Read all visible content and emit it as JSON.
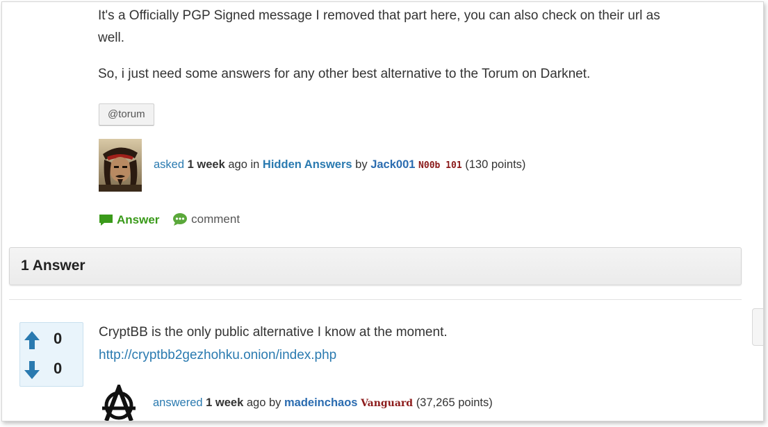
{
  "question": {
    "body_lines": [
      "It's a Officially PGP Signed message I removed that part here, you can also check on their url as",
      "well."
    ],
    "body_paragraph2": "So, i just need some answers for any other best alternative to the Torum on Darknet.",
    "tag": "@torum",
    "meta": {
      "action": "asked",
      "when": "1 week",
      "ago": "ago in",
      "category": "Hidden Answers",
      "by": "by",
      "user": "Jack001",
      "level": "N00b 101",
      "points": "(130 points)"
    },
    "actions": {
      "answer_label": "Answer",
      "comment_label": "comment"
    }
  },
  "answers_header": "1 Answer",
  "answer": {
    "votes_up": "0",
    "votes_down": "0",
    "text": "CryptBB is the only public alternative I know at the moment.",
    "link": "http://cryptbb2gezhohku.onion/index.php",
    "meta": {
      "action": "answered",
      "when": "1 week",
      "ago": "ago by",
      "user": "madeinchaos",
      "level": "Vanguard",
      "points": "(37,265 points)"
    }
  },
  "colors": {
    "link": "#2a7ab0",
    "answer_green": "#3a9a1a",
    "level_red": "#8b1a1a",
    "vote_bg": "#e9f4fb"
  },
  "icons": [
    "speech-bubble-icon",
    "comment-bubble-icon",
    "vote-up-arrow-icon",
    "vote-down-arrow-icon",
    "anarchy-avatar-icon"
  ]
}
